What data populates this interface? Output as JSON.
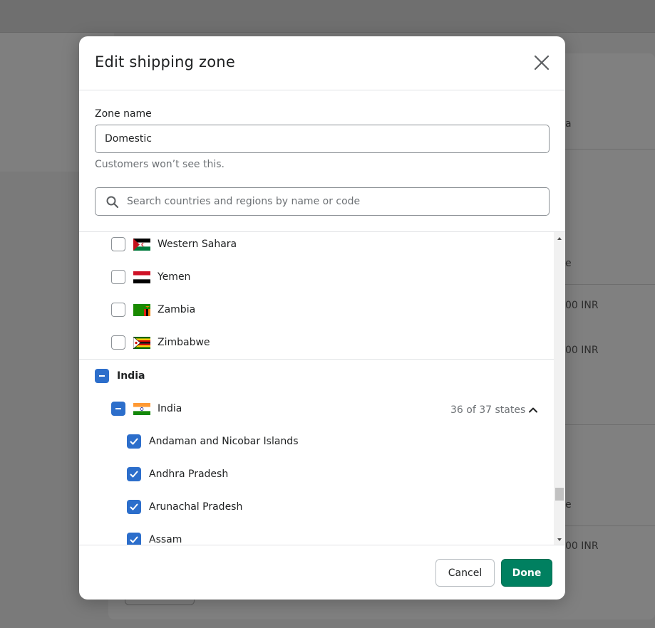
{
  "modal": {
    "title": "Edit shipping zone",
    "zone_name_label": "Zone name",
    "zone_name_value": "Domestic",
    "zone_name_help": "Customers won’t see this.",
    "search_placeholder": "Search countries and regions by name or code"
  },
  "country_list": [
    {
      "name": "Western Sahara",
      "checked": false,
      "flag": "western-sahara-flag"
    },
    {
      "name": "Yemen",
      "checked": false,
      "flag": "yemen-flag"
    },
    {
      "name": "Zambia",
      "checked": false,
      "flag": "zambia-flag"
    },
    {
      "name": "Zimbabwe",
      "checked": false,
      "flag": "zimbabwe-flag"
    }
  ],
  "selected_group": {
    "name": "India",
    "country": "India",
    "state_count": "36 of 37 states",
    "states": [
      {
        "name": "Andaman and Nicobar Islands",
        "checked": true
      },
      {
        "name": "Andhra Pradesh",
        "checked": true
      },
      {
        "name": "Arunachal Pradesh",
        "checked": true
      },
      {
        "name": "Assam",
        "checked": true
      }
    ]
  },
  "footer": {
    "cancel_label": "Cancel",
    "done_label": "Done"
  },
  "background": {
    "price_1": "00 INR",
    "price_2": "00 INR",
    "price_3": "00 INR",
    "fragment_a": "a",
    "fragment_b": "e",
    "fragment_c": "e"
  },
  "colors": {
    "primary": "#008060",
    "checkbox": "#2c6ecb",
    "overlay": "#7a7a7a"
  }
}
